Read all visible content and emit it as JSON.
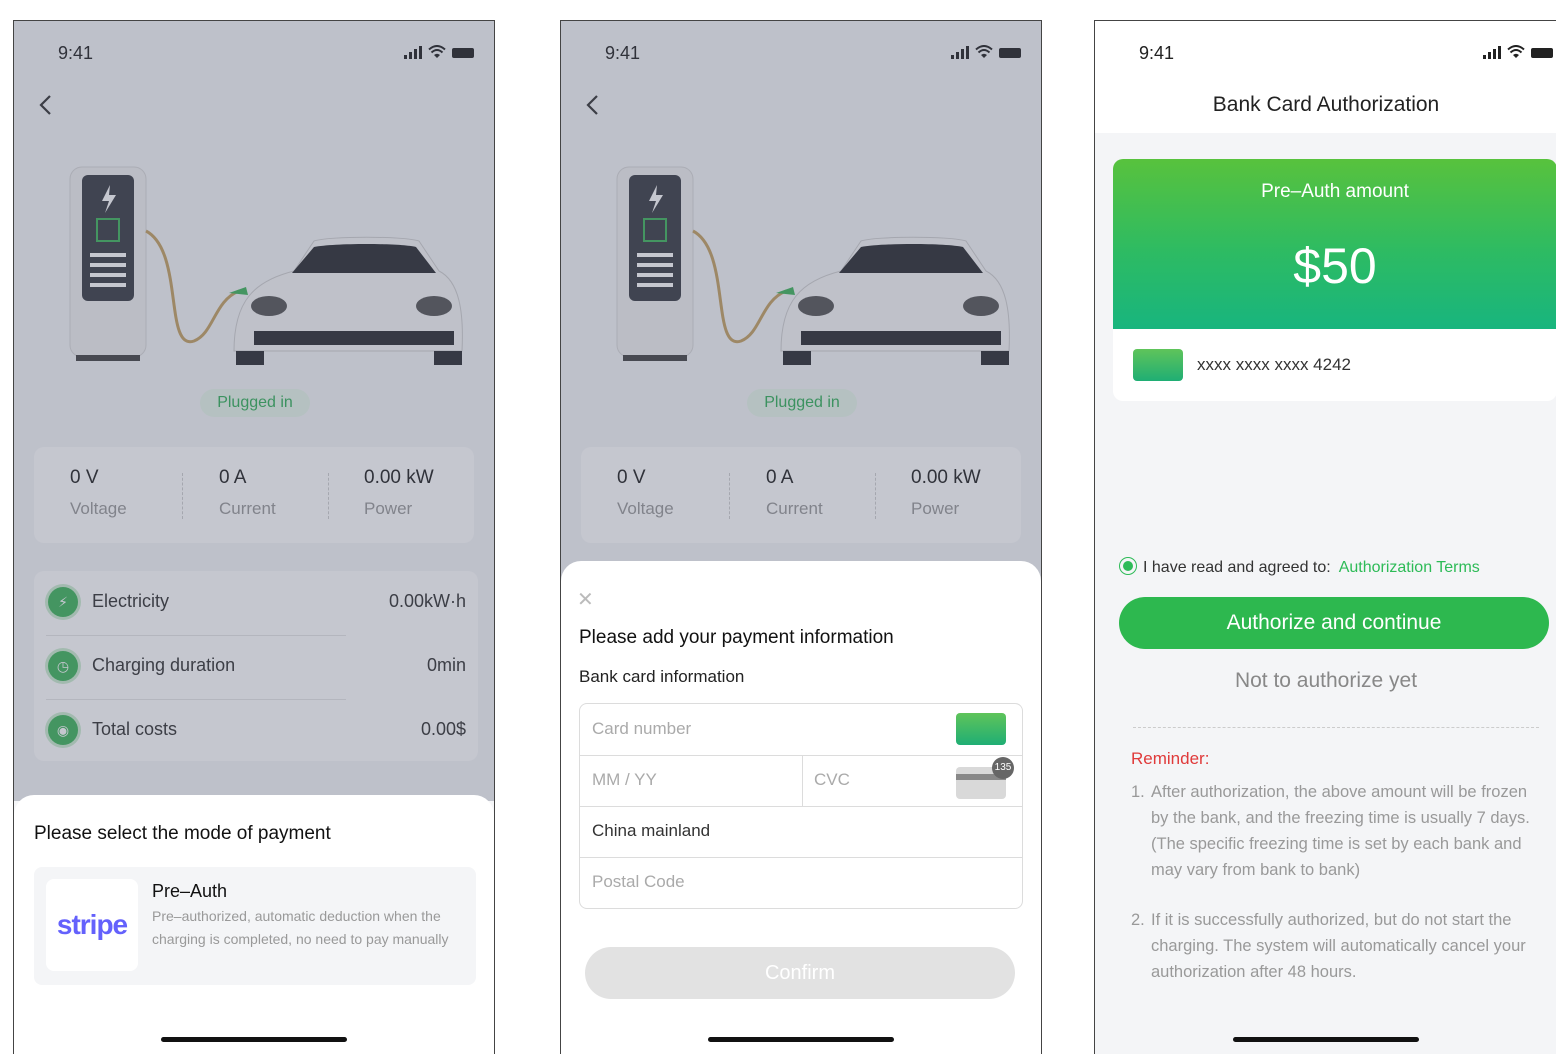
{
  "status": {
    "time": "9:41"
  },
  "charging": {
    "plugged_label": "Plugged in",
    "stats": [
      {
        "value": "0 V",
        "label": "Voltage"
      },
      {
        "value": "0 A",
        "label": "Current"
      },
      {
        "value": "0.00 kW",
        "label": "Power"
      }
    ],
    "rows": [
      {
        "label": "Electricity",
        "value": "0.00kW·h",
        "icon": "bolt-icon"
      },
      {
        "label": "Charging duration",
        "value": "0min",
        "icon": "clock-icon"
      },
      {
        "label": "Total costs",
        "value": "0.00$",
        "icon": "coin-icon"
      }
    ]
  },
  "payment_mode": {
    "title": "Please select the mode of payment",
    "option": {
      "logo_text": "stripe",
      "title": "Pre–Auth",
      "description": "Pre–authorized, automatic deduction when the charging is completed, no need to pay manually"
    }
  },
  "payment_info": {
    "title": "Please add your payment information",
    "subtitle": "Bank card information",
    "card_number_placeholder": "Card number",
    "expiry_placeholder": "MM / YY",
    "cvc_placeholder": "CVC",
    "cvc_badge": "135",
    "country": "China mainland",
    "postal_placeholder": "Postal Code",
    "confirm_label": "Confirm"
  },
  "authorization": {
    "title": "Bank Card Authorization",
    "amount_label": "Pre–Auth amount",
    "amount": "$50",
    "card_masked": "xxxx xxxx xxxx 4242",
    "agree_text": "I have read and agreed to:",
    "terms_link": "Authorization Terms",
    "authorize_label": "Authorize and continue",
    "decline_label": "Not to authorize yet",
    "reminder_title": "Reminder:",
    "reminders": [
      {
        "num": "1.",
        "text": "After authorization, the above amount will be frozen by the bank, and the freezing time is usually 7 days. (The specific freezing time is set by each bank and may vary from bank to bank)"
      },
      {
        "num": "2.",
        "text": "If it is successfully authorized, but do not start the charging. The system will automatically cancel your authorization after 48 hours."
      }
    ]
  },
  "colors": {
    "accent": "#2db84f",
    "stripe": "#6461fc",
    "reminder": "#e03a3a"
  }
}
